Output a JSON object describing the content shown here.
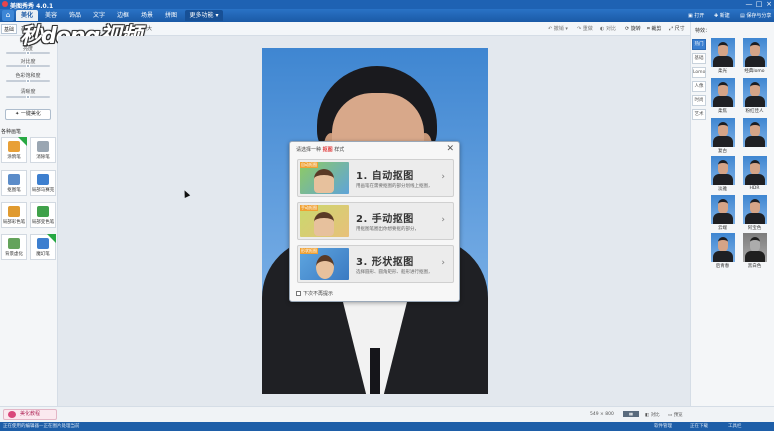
{
  "window": {
    "title": "美图秀秀 4.0.1",
    "controls": [
      "—",
      "□",
      "×"
    ]
  },
  "menu": {
    "home_icon": "home-icon",
    "tabs": [
      {
        "label": "美化",
        "active": true
      },
      {
        "label": "美容"
      },
      {
        "label": "饰品"
      },
      {
        "label": "文字"
      },
      {
        "label": "边框"
      },
      {
        "label": "场景"
      },
      {
        "label": "拼图"
      },
      {
        "label": "更多功能 ▾"
      }
    ],
    "open_label": "打开",
    "new_label": "新建",
    "save_label": "保存与分享"
  },
  "toolbar": {
    "subtabs": [
      "基础",
      "高级"
    ],
    "zoom_label": "原大",
    "actions": [
      "撤销",
      "重做",
      "对比",
      "预览",
      "旋转",
      "裁剪",
      "尺寸"
    ]
  },
  "left_panel": {
    "sliders": [
      {
        "label": "亮度",
        "value": 0.5
      },
      {
        "label": "对比度",
        "value": 0.5
      },
      {
        "label": "色彩饱和度",
        "value": 0.5
      },
      {
        "label": "清晰度",
        "value": 0.5
      }
    ],
    "onekey_label": "一键美化",
    "section_label": "各种画笔",
    "tools": [
      {
        "label": "涂鸦笔",
        "icon": "paint-pen-icon",
        "color": "#e8a037",
        "new": true
      },
      {
        "label": "消除笔",
        "icon": "eraser-icon",
        "color": "#9aa6b2",
        "new": false
      },
      {
        "label": "抠图笔",
        "icon": "cutout-icon",
        "color": "#5b8cc9",
        "new": false
      },
      {
        "label": "局部马赛克",
        "icon": "mosaic-icon",
        "color": "#3d7fcf",
        "new": false
      },
      {
        "label": "局部彩色笔",
        "icon": "color-brush-icon",
        "color": "#e09a2f",
        "new": false
      },
      {
        "label": "局部变色笔",
        "icon": "recolor-icon",
        "color": "#3fa14a",
        "new": false
      },
      {
        "label": "背景虚化",
        "icon": "blur-bg-icon",
        "color": "#64a35b",
        "new": false
      },
      {
        "label": "魔幻笔",
        "icon": "magic-pen-icon",
        "color": "#3d7fcf",
        "new": true
      }
    ]
  },
  "watermark": {
    "text": "秒dong视频"
  },
  "dialog": {
    "title_prefix": "请选择一种",
    "title_highlight": "抠图",
    "title_suffix": "样式",
    "options": [
      {
        "tag": "自动抠图",
        "title": "1. 自动抠图",
        "desc": "用画笔在需要抠图的部分划线上抠图，"
      },
      {
        "tag": "手动抠图",
        "title": "2. 手动抠图",
        "desc": "用抠图笔圈出你想要抠的部分，"
      },
      {
        "tag": "形状抠图",
        "title": "3. 形状抠图",
        "desc": "选择圆形、圆角矩形、船形进行抠图，"
      }
    ],
    "checkbox_label": "下次不再提示"
  },
  "right_panel": {
    "title": "特效：",
    "tabs": [
      "热门",
      "基础",
      "Lomo",
      "人像",
      "时尚",
      "艺术"
    ],
    "effects": [
      {
        "label": "柔光",
        "selected": false
      },
      {
        "label": "经典lomo",
        "selected": false
      },
      {
        "label": "柔焦",
        "selected": false
      },
      {
        "label": "粉红佳人",
        "selected": false
      },
      {
        "label": "复古",
        "selected": false
      },
      {
        "label": "",
        "selected": false
      },
      {
        "label": "淡雅",
        "selected": false
      },
      {
        "label": "HDR",
        "selected": false
      },
      {
        "label": "云端",
        "selected": false
      },
      {
        "label": "阿宝色",
        "selected": false
      },
      {
        "label": "后青春",
        "selected": false
      },
      {
        "label": "黑白色",
        "selected": false
      }
    ]
  },
  "statusbar": {
    "help_label": "美化教程",
    "dimensions": "549 × 800",
    "compare_label": "对比",
    "preview_label": "预览"
  },
  "taskbar": {
    "left_text": "正在使用的编辑器—正在图片处理当前",
    "items": [
      "软件管理",
      "正在下载",
      "工具栏"
    ]
  }
}
